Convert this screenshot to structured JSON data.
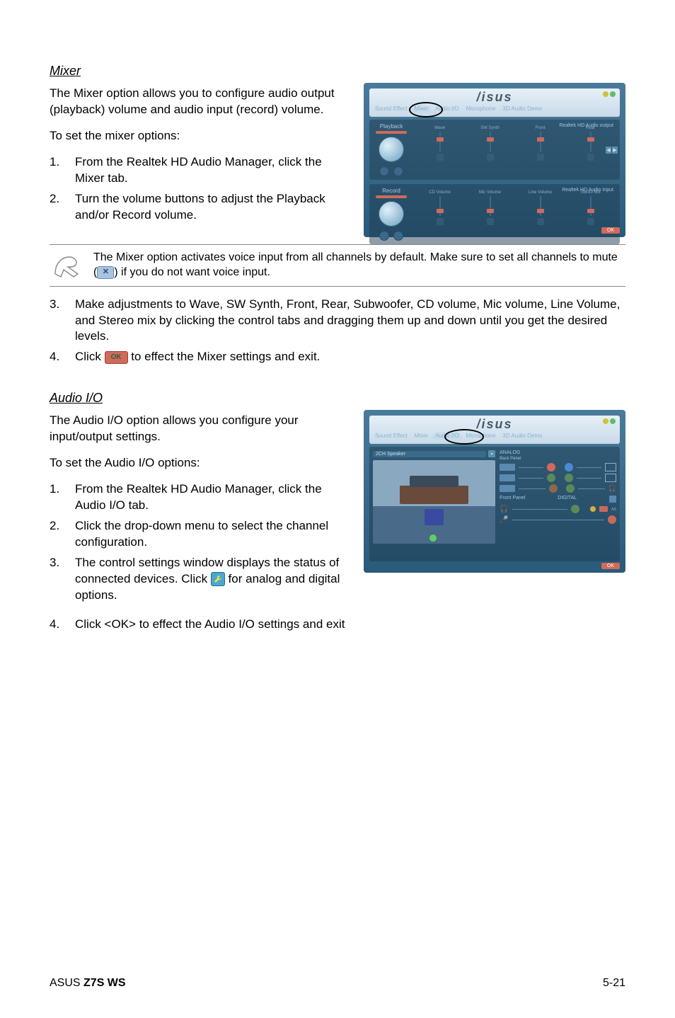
{
  "section1": {
    "title": "Mixer",
    "intro": "The Mixer option allows you to configure audio output (playback) volume and audio input (record) volume.",
    "to_set": "To set the mixer options:",
    "step1": "From the Realtek HD Audio Manager, click the Mixer tab.",
    "step2": "Turn the volume buttons to adjust the Playback and/or Record volume.",
    "note_pre": "The Mixer option activates voice input from all channels by default. Make sure to set all channels to mute (",
    "note_post": ") if you do not want voice input.",
    "step3": "Make adjustments to Wave, SW Synth, Front, Rear, Subwoofer, CD volume, Mic volume, Line Volume, and Stereo mix by clicking the control tabs and dragging them up and down until you get the desired levels.",
    "step4_pre": "Click ",
    "step4_post": " to effect the Mixer settings and exit."
  },
  "section2": {
    "title": "Audio I/O",
    "intro": "The Audio I/O option allows you configure your input/output settings.",
    "to_set": "To set the Audio I/O options:",
    "step1": "From the Realtek HD Audio Manager, click the Audio I/O tab.",
    "step2": "Click the drop-down menu to select the channel configuration.",
    "step3_pre": "The control settings window displays the status of connected devices. Click ",
    "step3_post": " for analog and digital options.",
    "step4": "Click <OK> to effect the Audio I/O settings and exit"
  },
  "app": {
    "logo": "/isus",
    "tabs": {
      "sound_effect": "Sound Effect",
      "mixer": "Mixer",
      "audio_io": "Audio I/O",
      "microphone": "Microphone",
      "demo": "3D Audio Demo"
    },
    "mixer": {
      "playback_label": "Playback",
      "record_label": "Record",
      "playback_group": "Realtek HD Audio output",
      "record_group": "Realtek HD Audio Input",
      "playback_sliders": [
        "Wave",
        "SW Synth",
        "Front",
        "Rear"
      ],
      "record_sliders": [
        "CD Volume",
        "Mic Volume",
        "Line Volume",
        "Stereo Mix"
      ]
    },
    "aio": {
      "speaker_select": "2CH Speaker",
      "analog_label": "ANALOG",
      "back_panel_label": "Back Panel",
      "front_panel_label": "Front Panel",
      "digital_label": "DIGITAL"
    },
    "ok": "OK"
  },
  "inline": {
    "mute_icon": "✕",
    "ok_btn": "OK"
  },
  "footer": {
    "brand": "ASUS ",
    "model": "Z7S WS",
    "page": "5-21"
  }
}
